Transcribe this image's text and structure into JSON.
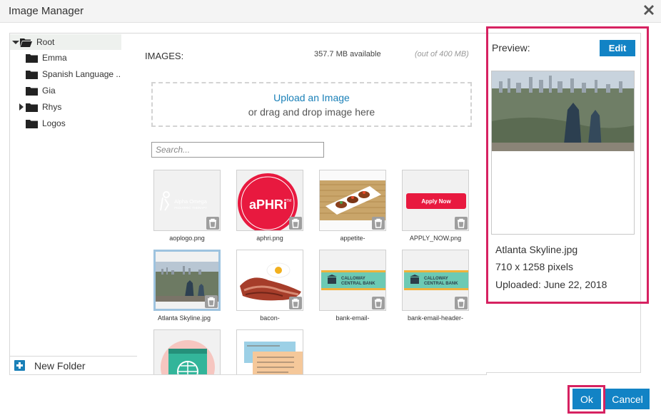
{
  "window": {
    "title": "Image Manager"
  },
  "tree": {
    "items": [
      {
        "label": "Root",
        "icon": "folder-open-icon",
        "expanded": true,
        "selected": true
      },
      {
        "label": "Emma",
        "icon": "folder-icon"
      },
      {
        "label": "Spanish Language ..",
        "icon": "folder-icon"
      },
      {
        "label": "Gia",
        "icon": "folder-icon"
      },
      {
        "label": "Rhys",
        "icon": "folder-icon",
        "collapsed_caret": true
      },
      {
        "label": "Logos",
        "icon": "folder-icon"
      }
    ],
    "new_folder_label": "New Folder"
  },
  "images": {
    "heading": "IMAGES:",
    "available": "357.7 MB available",
    "quota": "(out of 400 MB)",
    "upload_link": "Upload an Image",
    "drag_text": "or drag and drop image here",
    "search_placeholder": "Search...",
    "thumbnails": [
      {
        "name": "aoplogo.png",
        "logo_line1": "Alpha Omega",
        "logo_line2": "PEDIATRIC THERAPY"
      },
      {
        "name": "aphri.png",
        "logo_text": "aPHRi",
        "logo_tm": "TM"
      },
      {
        "name": "appetite-"
      },
      {
        "name": "APPLY_NOW.png",
        "button_text": "Apply Now"
      },
      {
        "name": "Atlanta Skyline.jpg",
        "selected": true
      },
      {
        "name": "bacon-"
      },
      {
        "name": "bank-email-",
        "bank_name_1": "CALLOWAY",
        "bank_name_2": "CENTRAL BANK"
      },
      {
        "name": "bank-email-header-",
        "bank_name_1": "CALLOWAY",
        "bank_name_2": "CENTRAL BANK"
      },
      {
        "name": ""
      },
      {
        "name": ""
      }
    ]
  },
  "preview": {
    "label": "Preview:",
    "edit_label": "Edit",
    "filename": "Atlanta Skyline.jpg",
    "dimensions": "710 x 1258 pixels",
    "uploaded": "Uploaded: June 22, 2018"
  },
  "footer": {
    "ok_label": "Ok",
    "cancel_label": "Cancel"
  },
  "colors": {
    "accent": "#1283c5",
    "highlight": "#d62261",
    "aphri_red": "#e8193f"
  }
}
